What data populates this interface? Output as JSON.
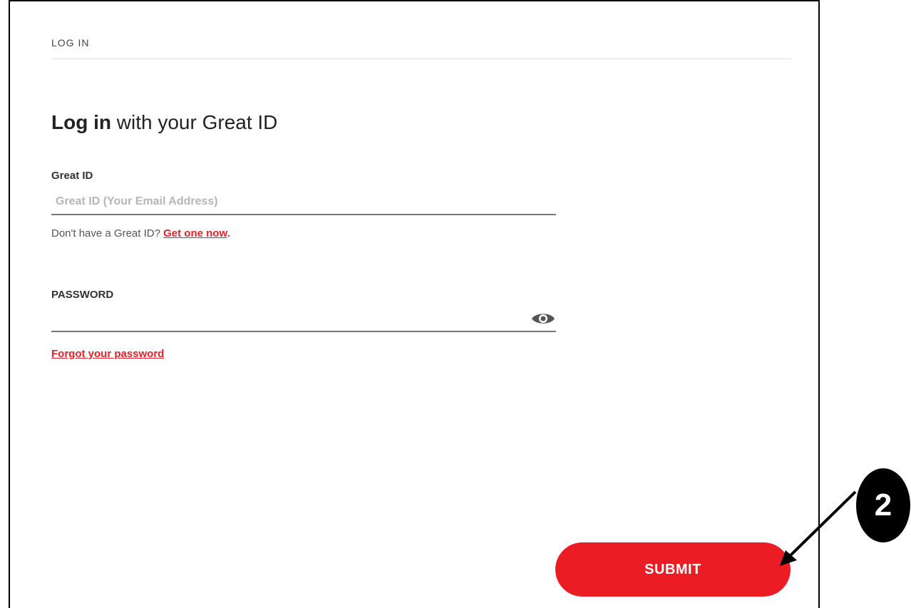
{
  "header": {
    "section_label": "LOG IN"
  },
  "title": {
    "bold_part": "Log in",
    "rest": " with your Great ID"
  },
  "email": {
    "label": "Great ID",
    "placeholder": "Great ID (Your Email Address)",
    "value": ""
  },
  "signup": {
    "prefix": "Don't have a Great ID? ",
    "link_label": "Get one now",
    "suffix": "."
  },
  "password": {
    "label": "PASSWORD",
    "value": "",
    "toggle_icon": "eye-icon"
  },
  "forgot": {
    "link_label": "Forgot your password"
  },
  "submit": {
    "label": "SUBMIT"
  },
  "annotation": {
    "step_number": "2"
  },
  "colors": {
    "accent": "#ec1c24",
    "link": "#e8202a",
    "text": "#222222"
  }
}
